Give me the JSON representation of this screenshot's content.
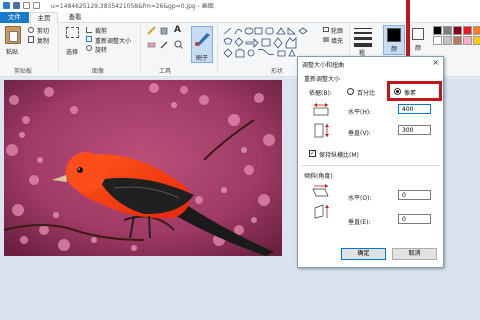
{
  "window": {
    "title": "u=1484625129,3835421058&fm=26&gp=0.jpg - 画图"
  },
  "tabs": [
    {
      "label": "文件"
    },
    {
      "label": "主页"
    },
    {
      "label": "查看"
    }
  ],
  "ribbon": {
    "clipboard": {
      "paste": "粘贴",
      "cut": "剪切",
      "copy": "复制",
      "group": "剪贴板"
    },
    "image": {
      "select": "选择",
      "crop": "裁剪",
      "resize": "重新调整大小",
      "rotate": "旋转",
      "group": "图像"
    },
    "tools": {
      "group": "工具"
    },
    "brushes": {
      "label": "刷子"
    },
    "shapes": {
      "outline": "轮廓",
      "fill": "填充",
      "group": "形状"
    },
    "size": {
      "label": "粗"
    },
    "color1": {
      "label": "颜"
    },
    "color2": {
      "label": "颜"
    }
  },
  "colors": {
    "accent": "#1979ca",
    "highlight": "#c0171d",
    "palette": [
      "#000000",
      "#7f7f7f",
      "#880015",
      "#ed1c24",
      "#ff7f27",
      "#ffffff",
      "#c3c3c3",
      "#b97a57",
      "#ffaec9",
      "#ffc90e"
    ]
  },
  "dialog": {
    "title": "调整大小和扭曲",
    "close": "×",
    "resize_section": "重新调整大小",
    "basis_label": "依据(B):",
    "percent_label": "百分比",
    "pixels_label": "像素",
    "selected_basis": "像素",
    "horizontal_label": "水平(H):",
    "horizontal_value": "400",
    "vertical_label": "垂直(V):",
    "vertical_value": "300",
    "keep_aspect_label": "保持纵横比(M)",
    "keep_aspect_checked": true,
    "skew_section": "倾斜(角度)",
    "skew_h_label": "水平(O):",
    "skew_h_value": "0",
    "skew_v_label": "垂直(E):",
    "skew_v_value": "0",
    "ok_label": "确定",
    "cancel_label": "取消"
  }
}
